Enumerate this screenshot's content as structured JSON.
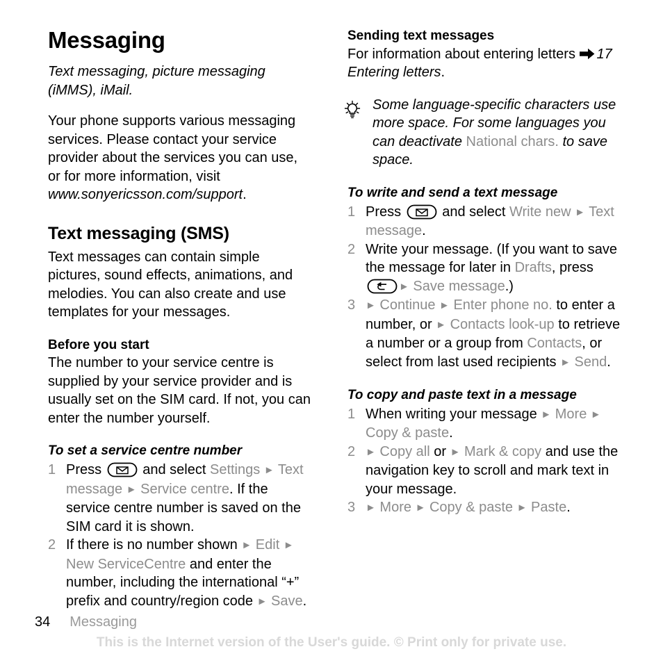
{
  "document": {
    "title": "Messaging",
    "lead": "Text messaging, picture messaging (iMMS), iMail.",
    "intro": "Your phone supports various messaging services. Please contact your service provider about the services you can use, or for more information, visit ",
    "intro_url": "www.sonyericsson.com/support",
    "intro_end": "."
  },
  "left_column": {
    "section_heading": "Text messaging (SMS)",
    "section_body": "Text messages can contain simple pictures, sound effects, animations, and melodies. You can also create and use templates for your messages.",
    "subheading": "Before you start",
    "subheading_body": "The number to your service centre is supplied by your service provider and is usually set on the SIM card. If not, you can enter the number yourself.",
    "procedure_heading": "To set a service centre number",
    "steps": [
      {
        "num": "1",
        "t1": "Press ",
        "key": "envelope-key-icon",
        "t2": " and select ",
        "m1": "Settings",
        "a1": "►",
        "m2": "Text message",
        "a2": "►",
        "m3": "Service centre",
        "t3": ". If the service centre number is saved on the SIM card it is shown."
      },
      {
        "num": "2",
        "t1": "If there is no number shown ",
        "a1": "►",
        "m1": "Edit",
        "a2": "►",
        "m2": "New ServiceCentre",
        "t2": " and enter the number, including the international “+” prefix and country/region code ",
        "a3": "►",
        "m3": "Save",
        "t3": "."
      }
    ]
  },
  "right_column": {
    "subheading": "Sending text messages",
    "subheading_body": "For information about entering letters ",
    "reference_arrow": "right-arrow-icon",
    "reference": "17 Entering letters",
    "reference_end": ".",
    "tip_icon": "lightbulb-icon",
    "tip": {
      "t1": "Some language-specific characters use more space. For some languages you can deactivate ",
      "m1": "National chars.",
      "t2": " to save space."
    },
    "procedure_1_heading": "To write and send a text message",
    "procedure_1_steps": [
      {
        "num": "1",
        "t1": "Press ",
        "key": "envelope-key-icon",
        "t2": " and select ",
        "m1": "Write new",
        "a1": "►",
        "m2": "Text message",
        "t3": "."
      },
      {
        "num": "2",
        "t1": "Write your message. (If you want to save the message for later in ",
        "m1": "Drafts",
        "t2": ", press ",
        "key": "back-key-icon",
        "a1": "►",
        "m2": "Save message",
        "t3": ".)"
      },
      {
        "num": "3",
        "a1": "►",
        "m1": "Continue",
        "a2": "►",
        "m2": "Enter phone no.",
        "t1": " to enter a number, or ",
        "a3": "►",
        "m3": "Contacts look-up",
        "t2": " to retrieve a number or a group from ",
        "m4": "Contacts",
        "t3": ", or select from last used recipients ",
        "a4": "►",
        "m5": "Send",
        "t4": "."
      }
    ],
    "procedure_2_heading": "To copy and paste text in a message",
    "procedure_2_steps": [
      {
        "num": "1",
        "t1": "When writing your message ",
        "a1": "►",
        "m1": "More",
        "a2": "►",
        "m2": "Copy & paste",
        "t2": "."
      },
      {
        "num": "2",
        "a1": "►",
        "m1": "Copy all",
        "t1": " or ",
        "a2": "►",
        "m2": "Mark & copy",
        "t2": " and use the navigation key to scroll and mark text in your message."
      },
      {
        "num": "3",
        "a1": "►",
        "m1": "More",
        "a2": "►",
        "m2": "Copy & paste",
        "a3": "►",
        "m3": "Paste",
        "t1": "."
      }
    ]
  },
  "footer": {
    "page_number": "34",
    "section_name": "Messaging",
    "watermark": "This is the Internet version of the User's guide. © Print only for private use."
  },
  "colors": {
    "text": "#000000",
    "menu_term": "#8c8c8c",
    "footer_section": "#9a9a9a",
    "watermark": "#d8d8d8"
  }
}
